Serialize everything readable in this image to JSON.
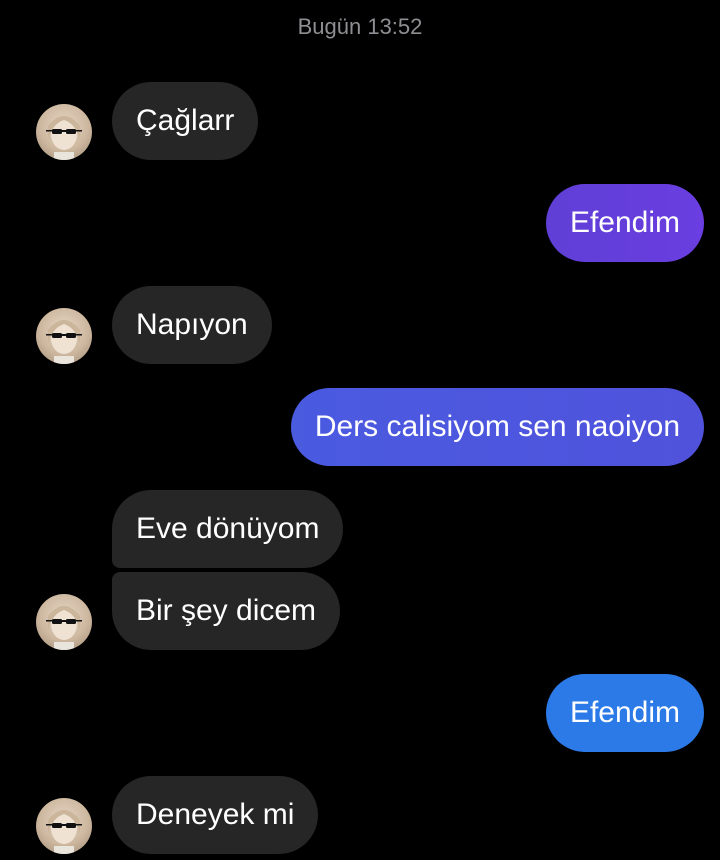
{
  "chat": {
    "timestamp": "Bugün 13:52",
    "messages": [
      {
        "direction": "incoming",
        "text": "Çağlarr"
      },
      {
        "direction": "outgoing",
        "text": "Efendim"
      },
      {
        "direction": "incoming",
        "text": "Napıyon"
      },
      {
        "direction": "outgoing",
        "text": "Ders calisiyom sen naoiyon"
      },
      {
        "direction": "incoming",
        "text": "Eve dönüyom"
      },
      {
        "direction": "incoming",
        "text": "Bir şey dicem"
      },
      {
        "direction": "outgoing",
        "text": "Efendim"
      },
      {
        "direction": "incoming",
        "text": "Deneyek mi"
      }
    ]
  },
  "colors": {
    "background": "#000000",
    "incoming_bubble": "#262626",
    "outgoing_purple": "#6a3ee0",
    "outgoing_indigo": "#4f55de",
    "outgoing_blue": "#2b7ae8",
    "timestamp_text": "#8e8e93"
  },
  "icons": {
    "avatar": "contact-avatar-with-sunglasses"
  }
}
